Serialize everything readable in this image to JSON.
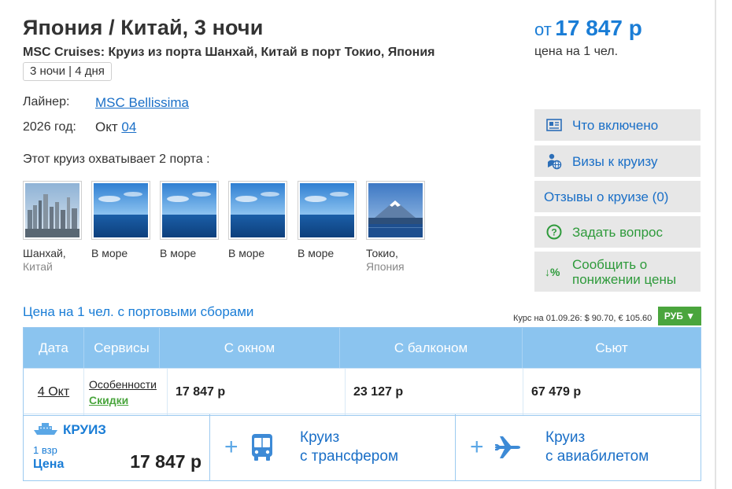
{
  "header": {
    "title": "Япония / Китай, 3  ночи",
    "subtitle": "MSC Cruises: Круиз из порта Шанхай, Китай в порт Токио, Япония",
    "duration": "3 ночи | 4 дня"
  },
  "price": {
    "from": "от",
    "value": "17 847 р",
    "note": "цена на 1 чел."
  },
  "info": {
    "liner_label": "Лайнер:",
    "liner_value": "MSC Bellissima",
    "year_label": "2026 год:",
    "month": "Окт",
    "day_link": "04"
  },
  "ports": {
    "intro": "Этот круиз охватывает 2 порта :",
    "items": [
      {
        "name": "Шанхай,",
        "country": "Китай",
        "image": "city-skyline"
      },
      {
        "name": "В море",
        "country": "",
        "image": "sea"
      },
      {
        "name": "В море",
        "country": "",
        "image": "sea"
      },
      {
        "name": "В море",
        "country": "",
        "image": "sea"
      },
      {
        "name": "В море",
        "country": "",
        "image": "sea"
      },
      {
        "name": "Токио,",
        "country": "Япония",
        "image": "mount-fuji"
      }
    ]
  },
  "side_menu": {
    "included": "Что включено",
    "visa": "Визы к круизу",
    "reviews": "Отзывы о круизе",
    "reviews_count": "(0)",
    "ask": "Задать вопрос",
    "price_drop": "Сообщить о понижении цены"
  },
  "pricing": {
    "caption": "Цена на 1 чел. с портовыми сборами",
    "rate": "Курс на 01.09.26: $ 90.70, € 105.60",
    "currency": "РУБ ▼"
  },
  "table": {
    "headers": [
      "Дата",
      "Сервисы",
      "С окном",
      "С балконом",
      "Сьют"
    ],
    "row": {
      "date": "4 Окт",
      "service1": "Особенности",
      "service2": "Скидки",
      "window": "17 847 р",
      "balcony": "23 127 р",
      "suite": "67 479 р"
    }
  },
  "bottom": {
    "cruise_title": "КРУИЗ",
    "pax": "1 взр",
    "price_label": "Цена",
    "price": "17 847 р",
    "transfer_line1": "Круиз",
    "transfer_line2": "с трансфером",
    "flight_line1": "Круиз",
    "flight_line2": "с авиабилетом"
  },
  "colors": {
    "accent": "#1a7dd6",
    "green": "#4aa53d",
    "table_header": "#8bc4ef",
    "side_button": "#e7e7e7"
  }
}
